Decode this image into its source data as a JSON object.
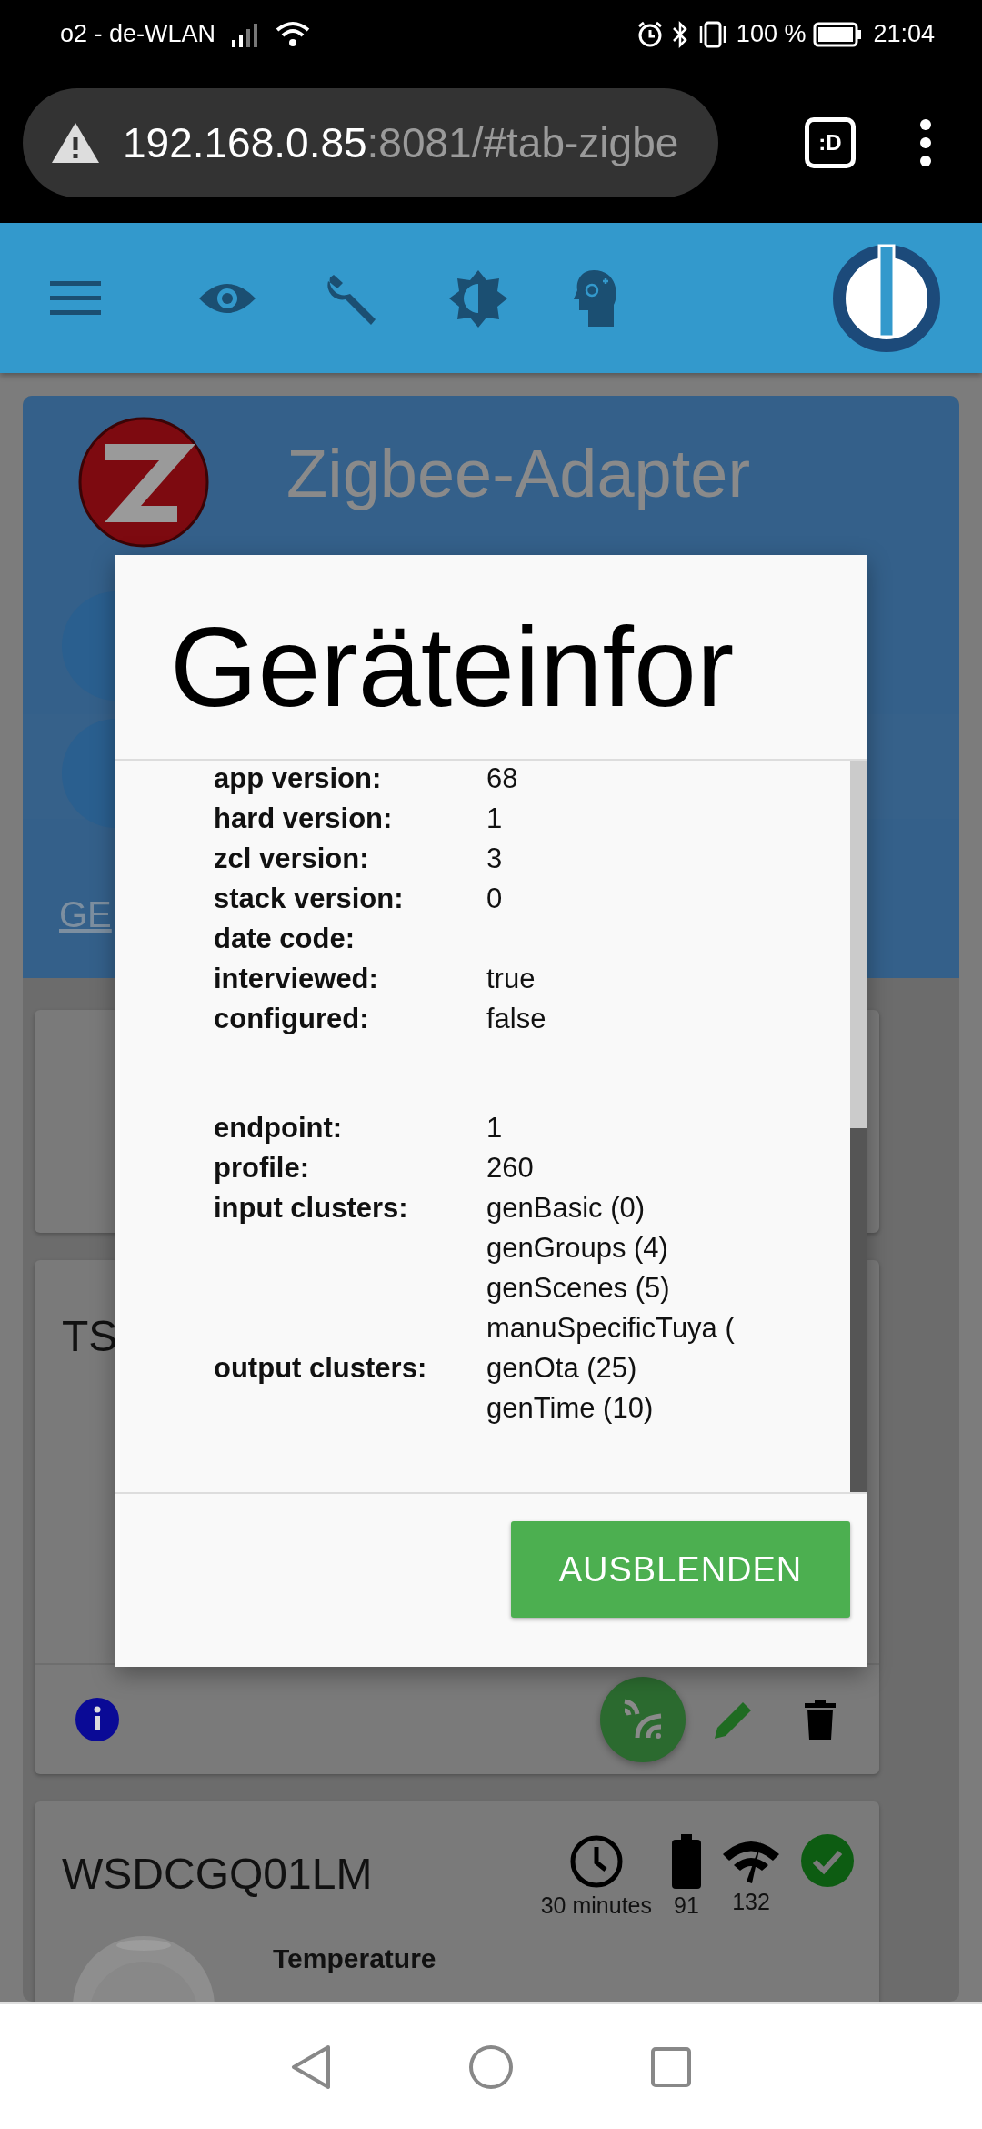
{
  "status_bar": {
    "carrier": "o2 - de-WLAN",
    "battery": "100 %",
    "time": "21:04"
  },
  "browser": {
    "url_host": "192.168.0.85",
    "url_rest": ":8081/#tab-zigbe",
    "tabs_label": ":D"
  },
  "adapter": {
    "title": "Zigbee-Adapter",
    "tab_label": "GE"
  },
  "devices": [
    {
      "name": "TS"
    },
    {
      "name": "WSDCGQ01LM",
      "online": true,
      "last_seen": "30 minutes",
      "battery": "91",
      "link_quality": "132",
      "readings": [
        {
          "label": "Temperature"
        }
      ]
    }
  ],
  "dialog": {
    "title": "Geräteinfor",
    "sections": [
      [
        {
          "label": "app version:",
          "values": [
            "68"
          ]
        },
        {
          "label": "hard version:",
          "values": [
            "1"
          ]
        },
        {
          "label": "zcl version:",
          "values": [
            "3"
          ]
        },
        {
          "label": "stack version:",
          "values": [
            "0"
          ]
        },
        {
          "label": "date code:"
        },
        {
          "label": "interviewed:",
          "values": [
            "true"
          ]
        },
        {
          "label": "configured:",
          "values": [
            "false"
          ]
        }
      ],
      [
        {
          "label": "endpoint:",
          "values": [
            "1"
          ]
        },
        {
          "label": "profile:",
          "values": [
            "260"
          ]
        },
        {
          "label": "input clusters:",
          "values": [
            "genBasic (0)",
            "genGroups (4)",
            "genScenes (5)",
            "manuSpecificTuya ("
          ]
        },
        {
          "label": "output clusters:",
          "values": [
            "genOta (25)",
            "genTime (10)"
          ]
        }
      ]
    ],
    "button": "AUSBLENDEN"
  }
}
